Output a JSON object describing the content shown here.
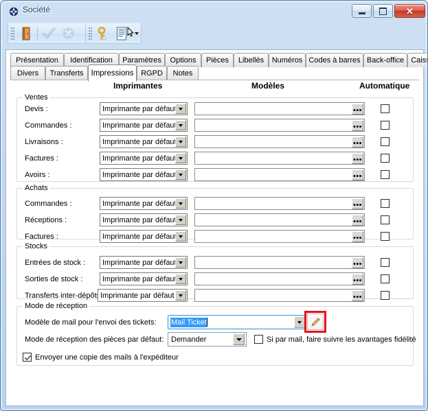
{
  "window": {
    "title": "Société",
    "icon": "app-compass-icon",
    "buttons": {
      "minimize": "Réduire",
      "maximize": "Agrandir",
      "close": "Fermer",
      "close_glyph": "✕"
    }
  },
  "toolbar": {
    "groups": [
      {
        "name": "navigation",
        "items": [
          {
            "name": "exit-door-icon",
            "label": "Quitter",
            "enabled": true
          },
          {
            "name": "separator",
            "label": "",
            "enabled": true
          },
          {
            "name": "validate-check-icon",
            "label": "Valider",
            "enabled": false
          },
          {
            "name": "cancel-x-icon",
            "label": "Annuler",
            "enabled": false
          }
        ]
      },
      {
        "name": "tools",
        "items": [
          {
            "name": "key-icon",
            "label": "Droits",
            "enabled": true
          },
          {
            "name": "report-list-icon",
            "label": "Éditions",
            "enabled": true,
            "has_dropdown": true
          }
        ]
      }
    ]
  },
  "tabs": {
    "row1": [
      {
        "label": "Présentation",
        "active": false
      },
      {
        "label": "Identification",
        "active": false
      },
      {
        "label": "Paramètres",
        "active": false
      },
      {
        "label": "Options",
        "active": false
      },
      {
        "label": "Pièces",
        "active": false
      },
      {
        "label": "Libellés",
        "active": false
      },
      {
        "label": "Numéros",
        "active": false
      },
      {
        "label": "Codes à barres",
        "active": false
      },
      {
        "label": "Back-office",
        "active": false
      },
      {
        "label": "Caisse",
        "active": false
      }
    ],
    "row2": [
      {
        "label": "Divers",
        "active": false
      },
      {
        "label": "Transferts",
        "active": false
      },
      {
        "label": "Impressions",
        "active": true
      },
      {
        "label": "RGPD",
        "active": false
      },
      {
        "label": "Notes",
        "active": false
      }
    ]
  },
  "columns": {
    "printers": "Imprimantes",
    "models": "Modèles",
    "automatic": "Automatique"
  },
  "default_printer": "Imprimante par défaut",
  "model_value": "",
  "groups": [
    {
      "title": "Ventes",
      "rows": [
        {
          "label": "Devis :",
          "printer": "Imprimante par défaut",
          "model": "",
          "auto": false
        },
        {
          "label": "Commandes :",
          "printer": "Imprimante par défaut",
          "model": "",
          "auto": false
        },
        {
          "label": "Livraisons :",
          "printer": "Imprimante par défaut",
          "model": "",
          "auto": false
        },
        {
          "label": "Factures :",
          "printer": "Imprimante par défaut",
          "model": "",
          "auto": false
        },
        {
          "label": "Avoirs :",
          "printer": "Imprimante par défaut",
          "model": "",
          "auto": false
        }
      ]
    },
    {
      "title": "Achats",
      "rows": [
        {
          "label": "Commandes :",
          "printer": "Imprimante par défaut",
          "model": "",
          "auto": false
        },
        {
          "label": "Réceptions :",
          "printer": "Imprimante par défaut",
          "model": "",
          "auto": false
        },
        {
          "label": "Factures :",
          "printer": "Imprimante par défaut",
          "model": "",
          "auto": false
        }
      ]
    },
    {
      "title": "Stocks",
      "rows": [
        {
          "label": "Entrées de stock :",
          "printer": "Imprimante par défaut",
          "model": "",
          "auto": false
        },
        {
          "label": "Sorties de stock :",
          "printer": "Imprimante par défaut",
          "model": "",
          "auto": false
        },
        {
          "label": "Transferts inter-dépôts :",
          "printer": "Imprimante par défaut",
          "model": "",
          "auto": false
        }
      ]
    }
  ],
  "reception": {
    "title": "Mode de réception",
    "mail_template_label": "Modèle de mail pour l'envoi des tickets:",
    "mail_template_value": "Mail Ticket",
    "edit_button": "edit-pencil-icon",
    "mode_label": "Mode de réception des pièces par défaut:",
    "mode_value": "Demander",
    "loyalty_checkbox_label": "Si par mail, faire suivre les avantages fidélité",
    "loyalty_checked": false,
    "copy_checkbox_label": "Envoyer une copie des mails à l'expéditeur",
    "copy_checked": true
  },
  "colors": {
    "highlight_red": "#e8111c",
    "selection_blue": "#3399ff",
    "focus_border": "#3c9bd0",
    "titlebar_text": "#12395e"
  }
}
